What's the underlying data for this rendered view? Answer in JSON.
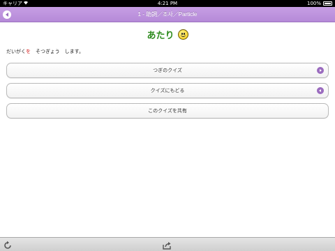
{
  "status_bar": {
    "carrier": "キャリア",
    "time": "4:21 PM",
    "battery": "100%"
  },
  "nav": {
    "title": "1 - 助詞／조사／Particle",
    "back_icon": "back-arrow-circle-icon"
  },
  "result": {
    "text": "あたり",
    "icon": "smiley-icon"
  },
  "sentence": {
    "before": "だいがく",
    "highlight": "を",
    "after": "　そつぎょう　します。",
    "highlight_color": "#d42020"
  },
  "buttons": {
    "next_quiz": "つぎのクイズ",
    "back_to_quiz": "クイズにもどる",
    "share_quiz": "このクイズを共有"
  },
  "toolbar": {
    "refresh_icon": "refresh-icon",
    "share_icon": "share-export-icon"
  },
  "colors": {
    "nav_purple": "#b58ad8",
    "accent_purple": "#9b6cbf",
    "correct_green": "#2e8b1e"
  }
}
